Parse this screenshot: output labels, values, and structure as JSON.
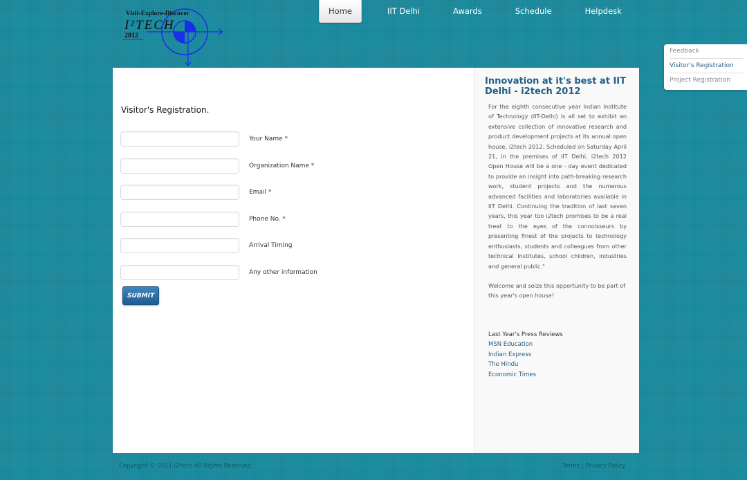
{
  "logo": {
    "tagline": "Visit-Explore-Discover",
    "brand": "I²TECH",
    "year": "2012"
  },
  "nav": {
    "items": [
      {
        "label": "Home"
      },
      {
        "label": "IIT Delhi"
      },
      {
        "label": "Awards"
      },
      {
        "label": "Schedule"
      },
      {
        "label": "Helpdesk"
      }
    ],
    "active": "Home"
  },
  "sidetabs": [
    {
      "label": "Feedback"
    },
    {
      "label": "Visitor's Registration"
    },
    {
      "label": "Project Registration"
    }
  ],
  "form": {
    "title": "Visitor's Registration.",
    "fields": [
      {
        "label": "Your Name *",
        "value": ""
      },
      {
        "label": "Organization Name *",
        "value": ""
      },
      {
        "label": "Email *",
        "value": ""
      },
      {
        "label": "Phone No. *",
        "value": ""
      },
      {
        "label": "Arrival Timing",
        "value": ""
      },
      {
        "label": "Any other information",
        "value": ""
      }
    ],
    "submit_label": "SUBMIT"
  },
  "sidebar": {
    "title": "Innovation at it's best at IIT Delhi - i2tech 2012",
    "paragraph1": "For the eighth consecutive year Indian Institute of Technology (IIT-Delhi) is all set to exhibit an extensive collection of innovative research and product development projects at its annual open house, i2tech 2012. Scheduled on Saturday April 21, in the premises of IIT Delhi, i2tech 2012 Open House will be a one - day event dedicated to provide an insight into path-breaking research work, student projects and the numerous advanced facilities and laboratories available in IIT Delhi. Continuing the tradition of last seven years, this year too i2tech promises to be a real treat to the eyes of the connoisseurs by presenting finest of the projects to technology enthusiasts, students and colleagues from other technical Institutes, school children, industries and general public.\"",
    "paragraph2": "Welcome and seize this opportunity to be part of this year's open house!",
    "press_heading": "Last Year's Press Reviews",
    "press_links": [
      {
        "label": "MSN Education"
      },
      {
        "label": "Indian Express"
      },
      {
        "label": "The Hindu"
      },
      {
        "label": "Economic Times"
      }
    ]
  },
  "footer": {
    "copyright": "Copyright © 2011 i2tech All Rights Reserved.",
    "terms": "Terms",
    "separator": "|",
    "privacy": "Privacy Policy"
  },
  "colors": {
    "background": "#1f8fa3",
    "accent": "#1f5e85",
    "logo_blue": "#1a2ee6",
    "logo_red": "#c0282d"
  }
}
